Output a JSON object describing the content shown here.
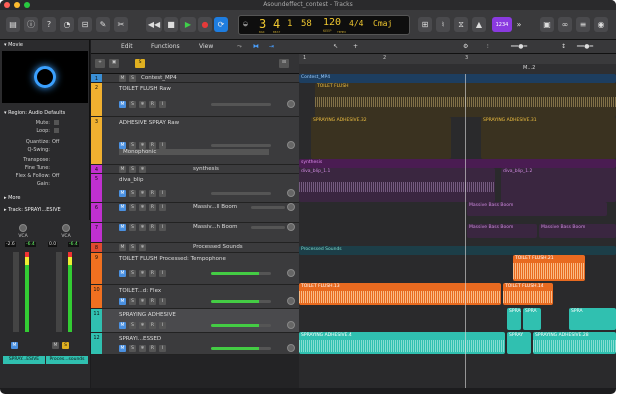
{
  "window": {
    "title": "Asoundeffect_contest - Tracks"
  },
  "lcd": {
    "bar": "3",
    "beat": "4",
    "div": "1",
    "tick": "58",
    "bpm": "120",
    "keep": "KEEP",
    "sig": "4/4",
    "key": "Cmaj",
    "lbl_bar": "BAR",
    "lbl_beat": "BEAT",
    "lbl_tempo": "TEMPO",
    "lbl_div": "DIV",
    "lbl_tick": "TICK"
  },
  "toolbar": {
    "count": "1234",
    "more": "»"
  },
  "inspector": {
    "movie": "Movie",
    "region": "Region: Audio Defaults",
    "mute": "Mute:",
    "loop": "Loop:",
    "quantize": "Quantize:",
    "quantize_val": "Off",
    "qswing": "Q-Swing:",
    "transpose": "Transpose:",
    "finetune": "Fine Tune:",
    "flexfollow": "Flex & Follow:",
    "flexfollow_val": "Off",
    "gain": "Gain:",
    "more": "More",
    "track": "Track:  SPRAYI...ESIVE"
  },
  "mixer": {
    "vca1": "VCA",
    "vca2": "VCA",
    "val1": "-2.6",
    "val2": "-6.4",
    "val3": "0.0",
    "val4": "-6.4",
    "m": "M",
    "s": "S",
    "name1": "SPRAY...ESIVE",
    "name2": "Proces...sounds"
  },
  "menubar": {
    "edit": "Edit",
    "functions": "Functions",
    "view": "View"
  },
  "ruler": {
    "m1": "1",
    "m2": "2",
    "m3": "3",
    "m4": "M...2"
  },
  "tracks": [
    {
      "num": "1",
      "name": "Contest_MP4",
      "color": "#3a8fd6"
    },
    {
      "num": "2",
      "name": "TOILET FLUSH Raw",
      "color": "#f0b030"
    },
    {
      "num": "3",
      "name": "ADHESIVE SPRAY Raw",
      "sub": "Monophonic",
      "color": "#f0b030"
    },
    {
      "num": "4",
      "name": "synthesis",
      "color": "#c030d0"
    },
    {
      "num": "5",
      "name": "diva_blip",
      "color": "#c030d0"
    },
    {
      "num": "6",
      "name": "Massiv...ll Boom",
      "color": "#c030d0"
    },
    {
      "num": "7",
      "name": "Massiv...h Boom",
      "color": "#c030d0"
    },
    {
      "num": "8",
      "name": "Processed Sounds",
      "color": "#e04a30"
    },
    {
      "num": "9",
      "name": "TOILET FLUSH Processed: Tempophone",
      "color": "#f07020"
    },
    {
      "num": "10",
      "name": "TOILET...d: Flex",
      "color": "#f07020"
    },
    {
      "num": "11",
      "name": "SPRAYING ADHESIVE",
      "color": "#30c0b0"
    },
    {
      "num": "12",
      "name": "SPRAYI...ESSED",
      "color": "#30c0b0"
    }
  ],
  "regions": {
    "r1": "Contest_MP4",
    "r2": "TOILET FLUSH",
    "r3": "SPRAYING ADHESIVE.32",
    "r4": "SPRAYING ADHESIVE.31",
    "r5": "synthesis",
    "r6": "diva_blip_1.1",
    "r7": "diva_blip_1.2",
    "r8": "Massive Bass Boom",
    "r9": "Massive Bass Boom",
    "r10": "Massive Bass Boom",
    "r11": "Processed Sounds",
    "r12": "TOILET FLUSH.21",
    "r13": "TOILET FLUSH.13",
    "r14": "TOILET FLUSH.14",
    "r15": "SPRA",
    "r16": "SPRA",
    "r17": "SPRA",
    "r18": "SPRAYING ADHESIVE.4",
    "r19": "SPRAY",
    "r20": "SPRAYING ADHESIVE.28"
  },
  "btns": {
    "m": "M",
    "s": "S",
    "r": "R",
    "i": "I",
    "star": "❄"
  }
}
